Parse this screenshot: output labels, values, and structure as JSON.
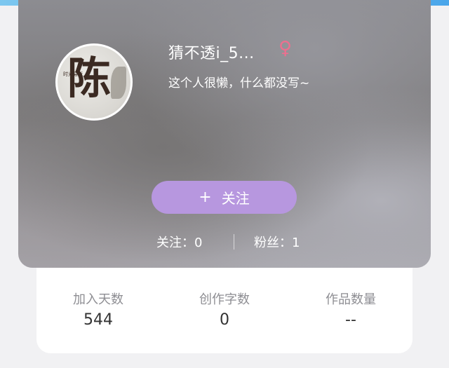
{
  "profile": {
    "username": "猜不透i_5...",
    "gender_symbol": "♀",
    "bio": "这个人很懒，什么都没写~",
    "avatar": {
      "main_char": "陈",
      "small_text": "时光易逝"
    }
  },
  "follow_button": {
    "icon": "+",
    "label": "关注"
  },
  "social_stats": {
    "following": "关注：0",
    "fans": "粉丝：1"
  },
  "info": [
    {
      "label": "加入天数",
      "value": "544"
    },
    {
      "label": "创作字数",
      "value": "0"
    },
    {
      "label": "作品数量",
      "value": "--"
    }
  ],
  "colors": {
    "top_bar_accent": "#4aa6ea",
    "follow_button": "#b797df",
    "gender_icon": "#ee6f8f"
  }
}
